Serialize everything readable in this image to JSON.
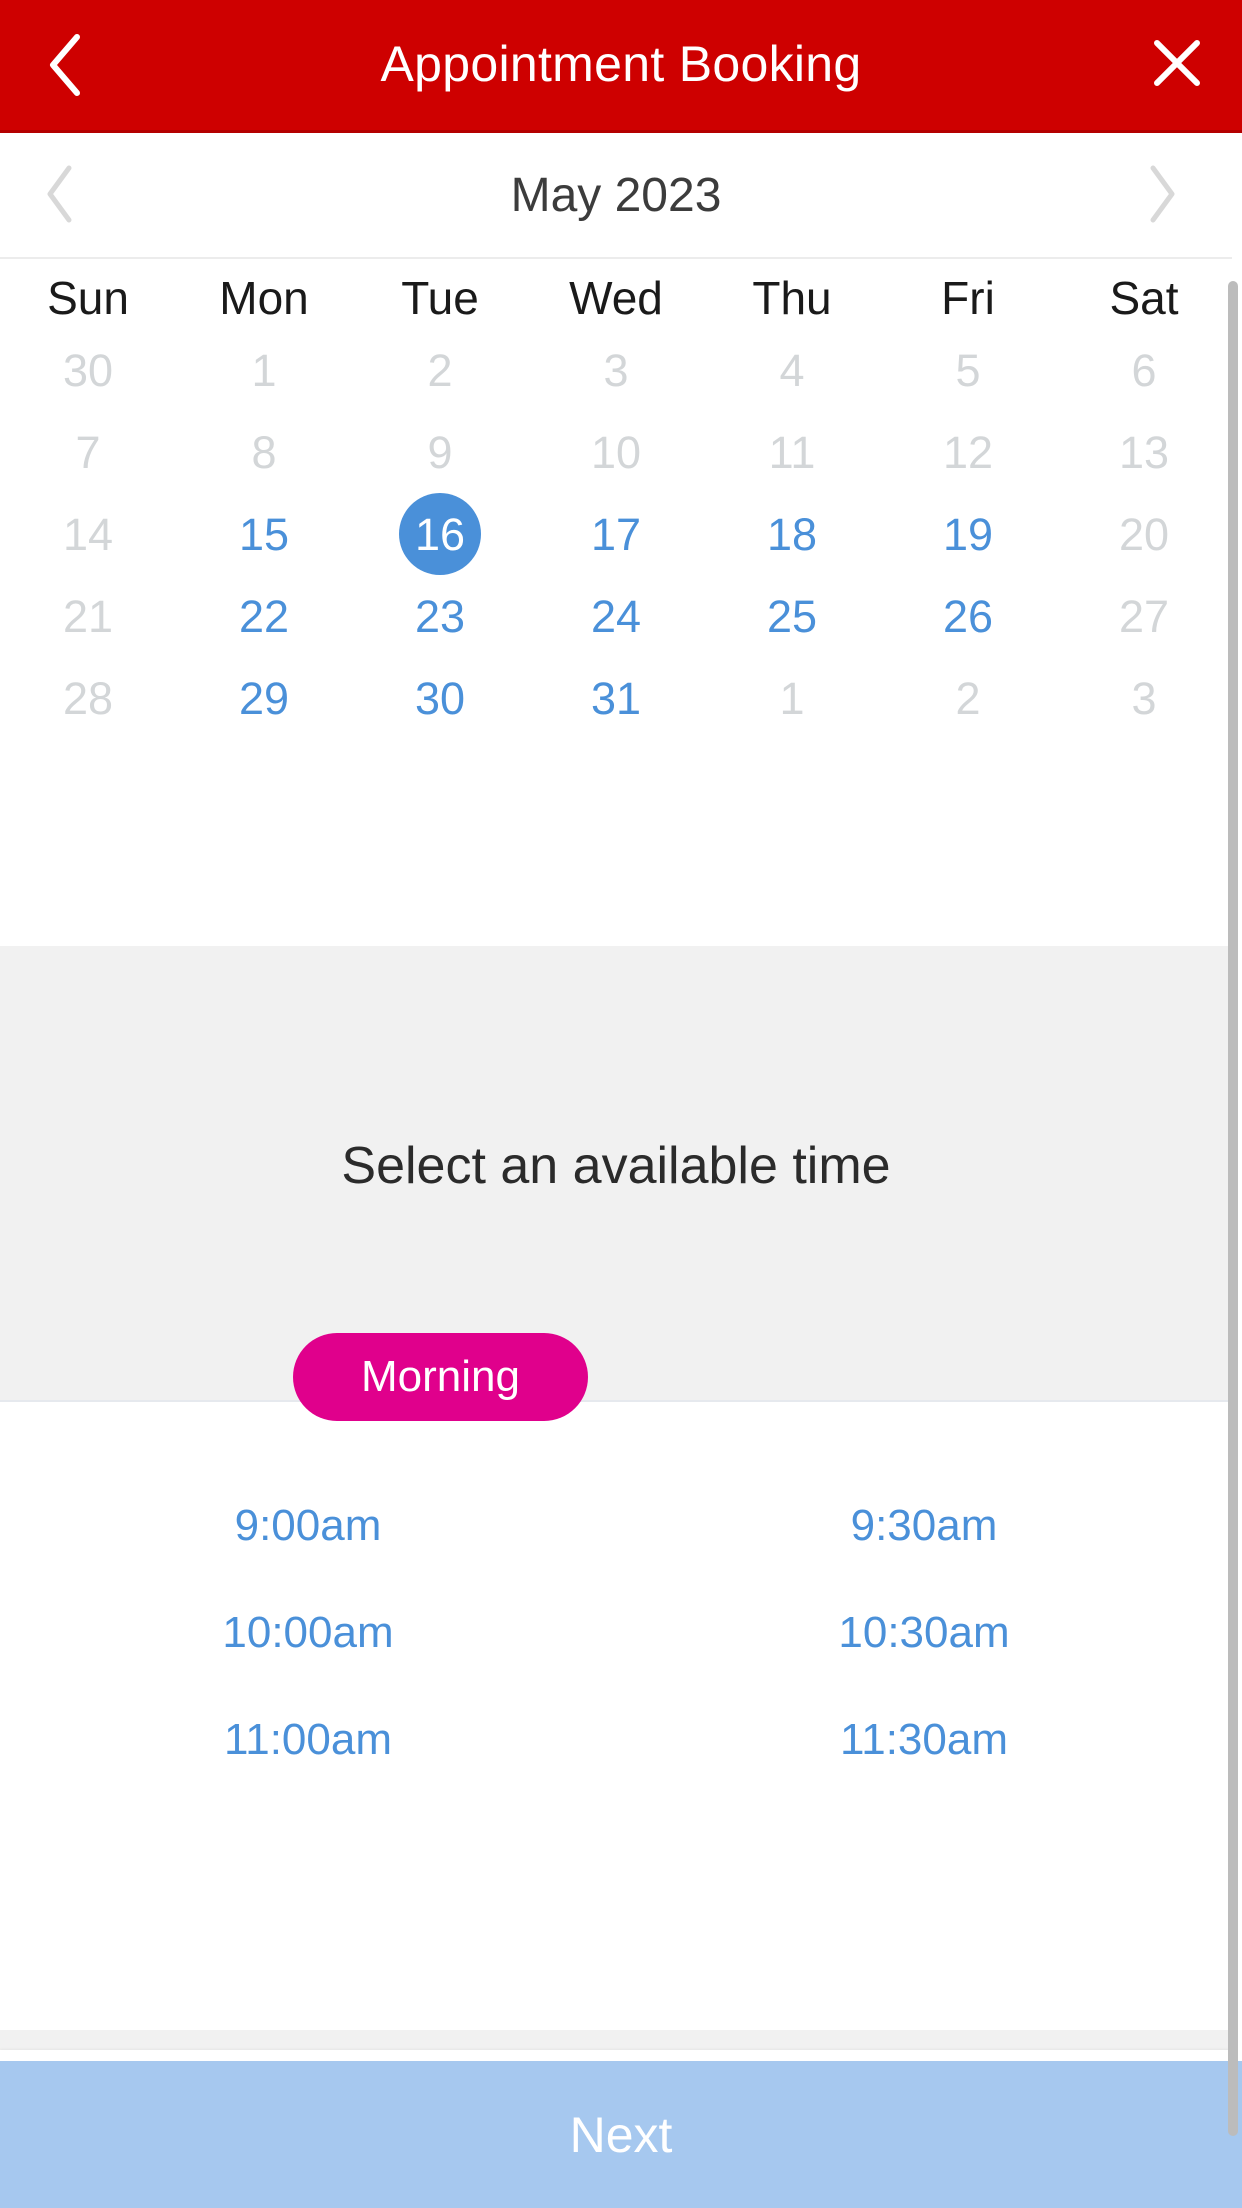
{
  "header": {
    "title": "Appointment Booking",
    "back_icon": "chevron-left-icon",
    "close_icon": "close-x-icon",
    "background_color": "#ce0000"
  },
  "calendar": {
    "month_label": "May 2023",
    "prev_icon": "chevron-left-icon",
    "next_icon": "chevron-right-icon",
    "weekdays": [
      "Sun",
      "Mon",
      "Tue",
      "Wed",
      "Thu",
      "Fri",
      "Sat"
    ],
    "selected_day": "16",
    "accent_color": "#4a90d9",
    "muted_color": "#d3d6d8",
    "weeks": [
      [
        {
          "label": "30",
          "state": "muted"
        },
        {
          "label": "1",
          "state": "muted"
        },
        {
          "label": "2",
          "state": "muted"
        },
        {
          "label": "3",
          "state": "muted"
        },
        {
          "label": "4",
          "state": "muted"
        },
        {
          "label": "5",
          "state": "muted"
        },
        {
          "label": "6",
          "state": "muted"
        }
      ],
      [
        {
          "label": "7",
          "state": "muted"
        },
        {
          "label": "8",
          "state": "muted"
        },
        {
          "label": "9",
          "state": "muted"
        },
        {
          "label": "10",
          "state": "muted"
        },
        {
          "label": "11",
          "state": "muted"
        },
        {
          "label": "12",
          "state": "muted"
        },
        {
          "label": "13",
          "state": "muted"
        }
      ],
      [
        {
          "label": "14",
          "state": "muted"
        },
        {
          "label": "15",
          "state": "avail"
        },
        {
          "label": "16",
          "state": "selected"
        },
        {
          "label": "17",
          "state": "avail"
        },
        {
          "label": "18",
          "state": "avail"
        },
        {
          "label": "19",
          "state": "avail"
        },
        {
          "label": "20",
          "state": "muted"
        }
      ],
      [
        {
          "label": "21",
          "state": "muted"
        },
        {
          "label": "22",
          "state": "avail"
        },
        {
          "label": "23",
          "state": "avail"
        },
        {
          "label": "24",
          "state": "avail"
        },
        {
          "label": "25",
          "state": "avail"
        },
        {
          "label": "26",
          "state": "avail"
        },
        {
          "label": "27",
          "state": "muted"
        }
      ],
      [
        {
          "label": "28",
          "state": "muted"
        },
        {
          "label": "29",
          "state": "avail"
        },
        {
          "label": "30",
          "state": "avail"
        },
        {
          "label": "31",
          "state": "avail"
        },
        {
          "label": "1",
          "state": "muted"
        },
        {
          "label": "2",
          "state": "muted"
        },
        {
          "label": "3",
          "state": "muted"
        }
      ]
    ]
  },
  "time_section": {
    "title": "Select an available time",
    "period_label": "Morning",
    "period_color": "#e0008c",
    "slot_color": "#4a90d9",
    "slots": [
      "9:00am",
      "9:30am",
      "10:00am",
      "10:30am",
      "11:00am",
      "11:30am"
    ]
  },
  "footer": {
    "next_label": "Next",
    "next_color": "#a6c8ef"
  }
}
